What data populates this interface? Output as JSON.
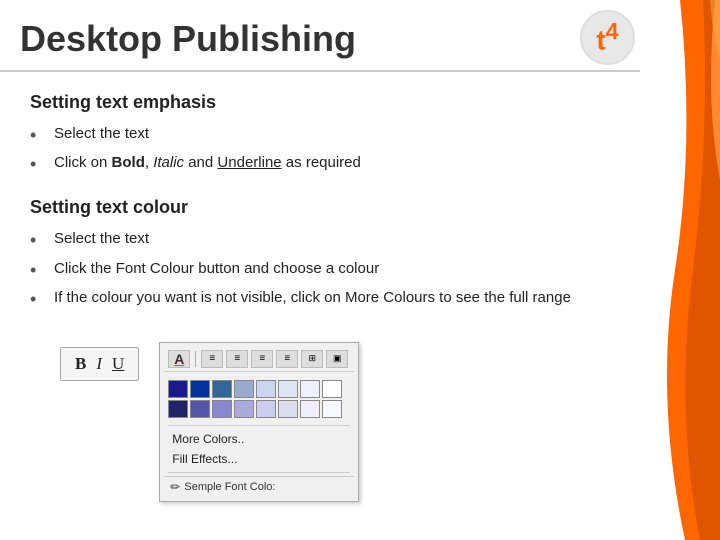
{
  "header": {
    "title": "Desktop Publishing",
    "logo_text": "t",
    "logo_superscript": "4"
  },
  "section1": {
    "heading": "Setting text emphasis",
    "bullets": [
      "Select the text",
      "Click on Bold, Italic and Underline as required"
    ],
    "biu": {
      "bold": "B",
      "italic": "I",
      "underline": "U"
    }
  },
  "section2": {
    "heading": "Setting text colour",
    "bullets": [
      "Select the text",
      "Click the Font Colour button and choose a colour",
      "If the  colour you want is not visible, click on More Colours to see the full range"
    ]
  },
  "color_picker": {
    "more_colors": "More Colors..",
    "fill_effects": "Fill Effects...",
    "sample_font": "Semple Font Colo:"
  },
  "colors": [
    "#1a1a8c",
    "#003399",
    "#0066cc",
    "#3399ff",
    "#aaccff",
    "#ccddff",
    "#eeeeff",
    "#ffffff",
    "#660000",
    "#990000",
    "#cc3300",
    "#ff6600",
    "#ffaa44",
    "#ffddaa",
    "#fff5dd",
    "#ffffff"
  ]
}
